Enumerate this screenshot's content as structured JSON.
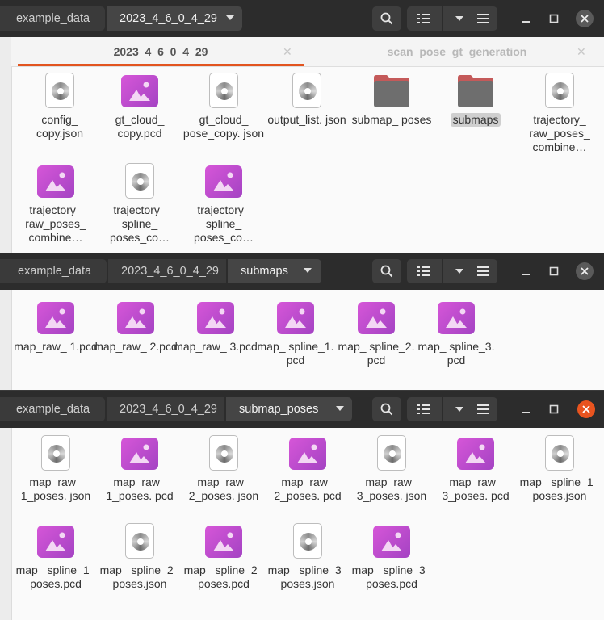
{
  "colors": {
    "headerbar": "#2c2c2c",
    "accent": "#e9541f",
    "content_bg": "#fafafa",
    "image_icon": "#c24fd0"
  },
  "window1": {
    "breadcrumbs": [
      "example_data",
      "2023_4_6_0_4_29"
    ],
    "tabs": [
      {
        "label": "2023_4_6_0_4_29",
        "active": true
      },
      {
        "label": "scan_pose_gt_generation",
        "active": false
      }
    ],
    "items": [
      {
        "label": "config_ copy.json",
        "icon": "json-file-icon"
      },
      {
        "label": "gt_cloud_ copy.pcd",
        "icon": "image-file-icon"
      },
      {
        "label": "gt_cloud_ pose_copy. json",
        "icon": "json-file-icon"
      },
      {
        "label": "output_list. json",
        "icon": "json-file-icon"
      },
      {
        "label": "submap_ poses",
        "icon": "folder-icon"
      },
      {
        "label": "submaps",
        "icon": "folder-icon",
        "selected": true
      },
      {
        "label": "trajectory_ raw_poses_ combine…",
        "icon": "json-file-icon"
      },
      {
        "label": "trajectory_ raw_poses_ combine…",
        "icon": "image-file-icon"
      },
      {
        "label": "trajectory_ spline_ poses_co…",
        "icon": "json-file-icon"
      },
      {
        "label": "trajectory_ spline_ poses_co…",
        "icon": "image-file-icon"
      }
    ]
  },
  "window2": {
    "breadcrumbs": [
      "example_data",
      "2023_4_6_0_4_29",
      "submaps"
    ],
    "items": [
      {
        "label": "map_raw_ 1.pcd",
        "icon": "image-file-icon"
      },
      {
        "label": "map_raw_ 2.pcd",
        "icon": "image-file-icon"
      },
      {
        "label": "map_raw_ 3.pcd",
        "icon": "image-file-icon"
      },
      {
        "label": "map_ spline_1. pcd",
        "icon": "image-file-icon"
      },
      {
        "label": "map_ spline_2. pcd",
        "icon": "image-file-icon"
      },
      {
        "label": "map_ spline_3. pcd",
        "icon": "image-file-icon"
      }
    ]
  },
  "window3": {
    "breadcrumbs": [
      "example_data",
      "2023_4_6_0_4_29",
      "submap_poses"
    ],
    "items": [
      {
        "label": "map_raw_ 1_poses. json",
        "icon": "json-file-icon"
      },
      {
        "label": "map_raw_ 1_poses. pcd",
        "icon": "image-file-icon"
      },
      {
        "label": "map_raw_ 2_poses. json",
        "icon": "json-file-icon"
      },
      {
        "label": "map_raw_ 2_poses. pcd",
        "icon": "image-file-icon"
      },
      {
        "label": "map_raw_ 3_poses. json",
        "icon": "json-file-icon"
      },
      {
        "label": "map_raw_ 3_poses. pcd",
        "icon": "image-file-icon"
      },
      {
        "label": "map_ spline_1_ poses.json",
        "icon": "json-file-icon"
      },
      {
        "label": "map_ spline_1_ poses.pcd",
        "icon": "image-file-icon"
      },
      {
        "label": "map_ spline_2_ poses.json",
        "icon": "json-file-icon"
      },
      {
        "label": "map_ spline_2_ poses.pcd",
        "icon": "image-file-icon"
      },
      {
        "label": "map_ spline_3_ poses.json",
        "icon": "json-file-icon"
      },
      {
        "label": "map_ spline_3_ poses.pcd",
        "icon": "image-file-icon"
      }
    ]
  }
}
